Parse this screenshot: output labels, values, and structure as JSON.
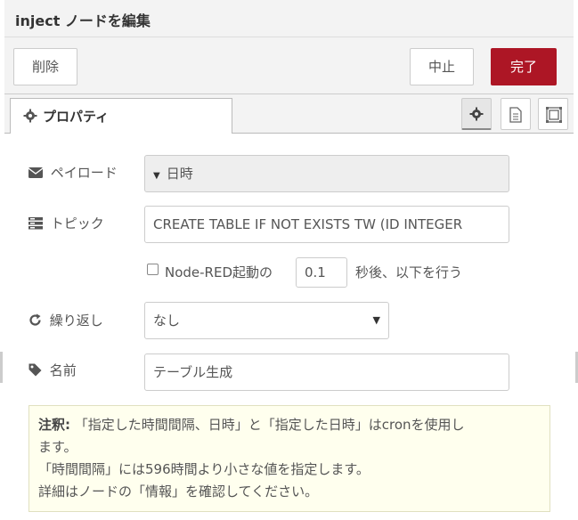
{
  "header": {
    "title": "inject ノードを編集"
  },
  "toolbar": {
    "delete_label": "削除",
    "cancel_label": "中止",
    "done_label": "完了",
    "done_color": "#ad1625"
  },
  "tabs": {
    "properties_label": "プロパティ",
    "icons": [
      "gear-icon",
      "description-icon",
      "appearance-icon"
    ]
  },
  "form": {
    "payload": {
      "label": "ペイロード",
      "value": "日時"
    },
    "topic": {
      "label": "トピック",
      "value": "CREATE TABLE IF NOT EXISTS TW (ID INTEGER"
    },
    "once": {
      "prefix": "Node-RED起動の",
      "delay": "0.1",
      "suffix": "秒後、以下を行う",
      "checked": false
    },
    "repeat": {
      "label": "繰り返し",
      "value": "なし"
    },
    "name": {
      "label": "名前",
      "value": "テーブル生成"
    }
  },
  "tip": {
    "bold": "注釈:",
    "line1": "「指定した時間間隔、日時」と「指定した日時」はcronを使用し",
    "line2": "ます。",
    "line3": "「時間間隔」には596時間より小さな値を指定します。",
    "line4": "詳細はノードの「情報」を確認してください。"
  }
}
